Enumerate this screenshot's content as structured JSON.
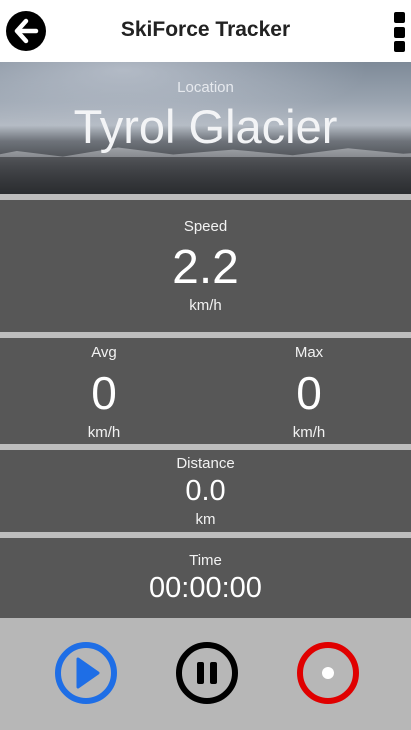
{
  "header": {
    "title": "SkiForce Tracker",
    "back_icon": "arrow-left-icon",
    "menu_icon": "more-vertical-icon"
  },
  "location": {
    "label": "Location",
    "value": "Tyrol Glacier"
  },
  "speed": {
    "label": "Speed",
    "value": "2.2",
    "unit": "km/h"
  },
  "avg": {
    "label": "Avg",
    "value": "0",
    "unit": "km/h"
  },
  "max": {
    "label": "Max",
    "value": "0",
    "unit": "km/h"
  },
  "distance": {
    "label": "Distance",
    "value": "0.0",
    "unit": "km"
  },
  "time": {
    "label": "Time",
    "value": "00:00:00"
  },
  "controls": {
    "play_icon": "play-icon",
    "pause_icon": "pause-icon",
    "record_icon": "record-icon",
    "colors": {
      "play": "#1e6ee6",
      "pause": "#000000",
      "record": "#e00000"
    }
  }
}
